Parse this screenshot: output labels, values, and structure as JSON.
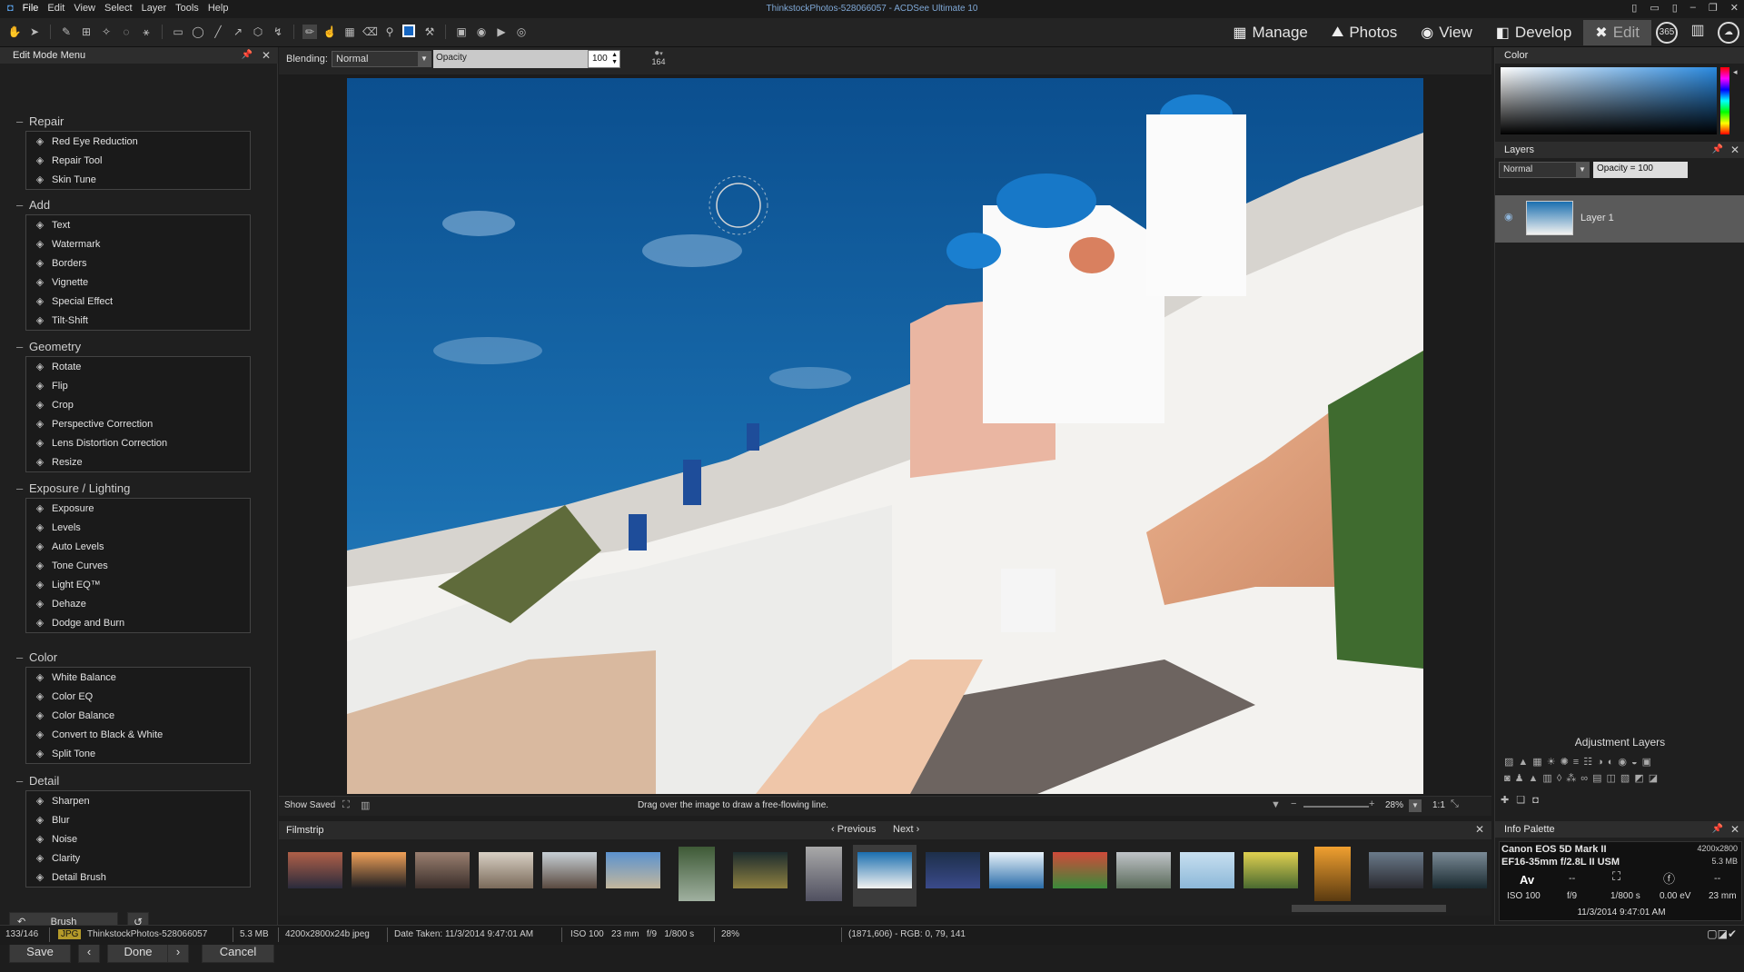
{
  "app": {
    "title": "ThinkstockPhotos-528066057 - ACDSee Ultimate 10"
  },
  "menu": [
    "File",
    "Edit",
    "View",
    "Select",
    "Layer",
    "Tools",
    "Help"
  ],
  "modes": [
    {
      "label": "Manage",
      "icon": "grid-icon"
    },
    {
      "label": "Photos",
      "icon": "photos-icon"
    },
    {
      "label": "View",
      "icon": "eye-icon"
    },
    {
      "label": "Develop",
      "icon": "develop-icon"
    },
    {
      "label": "Edit",
      "icon": "edit-icon",
      "active": true
    }
  ],
  "options": {
    "blending_label": "Blending:",
    "blending_value": "Normal",
    "opacity_label": "Opacity",
    "opacity_value": "100",
    "brush_size": "164"
  },
  "edit_menu": {
    "title": "Edit Mode Menu",
    "groups": [
      {
        "title": "Repair",
        "items": [
          {
            "label": "Red Eye Reduction",
            "icon": "eye-icon"
          },
          {
            "label": "Repair Tool",
            "icon": "bandage-icon"
          },
          {
            "label": "Skin Tune",
            "icon": "person-icon"
          }
        ]
      },
      {
        "title": "Add",
        "items": [
          {
            "label": "Text",
            "icon": "text-icon"
          },
          {
            "label": "Watermark",
            "icon": "watermark-icon"
          },
          {
            "label": "Borders",
            "icon": "borders-icon"
          },
          {
            "label": "Vignette",
            "icon": "vignette-icon"
          },
          {
            "label": "Special Effect",
            "icon": "wand-icon"
          },
          {
            "label": "Tilt-Shift",
            "icon": "tilt-shift-icon"
          }
        ]
      },
      {
        "title": "Geometry",
        "items": [
          {
            "label": "Rotate",
            "icon": "rotate-icon"
          },
          {
            "label": "Flip",
            "icon": "flip-icon"
          },
          {
            "label": "Crop",
            "icon": "crop-icon"
          },
          {
            "label": "Perspective Correction",
            "icon": "perspective-icon"
          },
          {
            "label": "Lens Distortion Correction",
            "icon": "lens-icon"
          },
          {
            "label": "Resize",
            "icon": "resize-icon"
          }
        ]
      },
      {
        "title": "Exposure / Lighting",
        "items": [
          {
            "label": "Exposure",
            "icon": "exposure-icon"
          },
          {
            "label": "Levels",
            "icon": "levels-icon"
          },
          {
            "label": "Auto Levels",
            "icon": "auto-levels-icon"
          },
          {
            "label": "Tone Curves",
            "icon": "curves-icon"
          },
          {
            "label": "Light EQ™",
            "icon": "light-eq-icon"
          },
          {
            "label": "Dehaze",
            "icon": "dehaze-icon"
          },
          {
            "label": "Dodge and Burn",
            "icon": "dodge-burn-icon"
          }
        ]
      },
      {
        "title": "Color",
        "items": [
          {
            "label": "White Balance",
            "icon": "white-balance-icon"
          },
          {
            "label": "Color EQ",
            "icon": "color-eq-icon"
          },
          {
            "label": "Color Balance",
            "icon": "color-balance-icon"
          },
          {
            "label": "Convert to Black & White",
            "icon": "bw-icon"
          },
          {
            "label": "Split Tone",
            "icon": "split-tone-icon"
          }
        ]
      },
      {
        "title": "Detail",
        "items": [
          {
            "label": "Sharpen",
            "icon": "sharpen-icon"
          },
          {
            "label": "Blur",
            "icon": "blur-icon"
          },
          {
            "label": "Noise",
            "icon": "noise-icon"
          },
          {
            "label": "Clarity",
            "icon": "clarity-icon"
          },
          {
            "label": "Detail Brush",
            "icon": "detail-brush-icon"
          }
        ]
      }
    ],
    "brush_label": "Brush",
    "save": "Save",
    "done": "Done",
    "cancel": "Cancel"
  },
  "canvas": {
    "show_saved": "Show Saved",
    "hint": "Drag over the image to draw a free-flowing line.",
    "zoom": "28%",
    "ratio": "1:1"
  },
  "filmstrip": {
    "title": "Filmstrip",
    "previous": "Previous",
    "next": "Next"
  },
  "color_panel": {
    "title": "Color"
  },
  "layers": {
    "title": "Layers",
    "blend": "Normal",
    "opacity": "Opacity = 100",
    "layer_name": "Layer 1",
    "adjustment_title": "Adjustment Layers"
  },
  "info": {
    "title": "Info Palette",
    "camera": "Canon EOS 5D Mark II",
    "lens": "EF16-35mm f/2.8L II USM",
    "dims": "4200x2800",
    "size": "5.3 MB",
    "mode": "Av",
    "meter": "--",
    "exp_comp": "--",
    "iso": "ISO 100",
    "fstop": "f/9",
    "shutter": "1/800 s",
    "ev": "0.00 eV",
    "focal": "23 mm",
    "date": "11/3/2014 9:47:01 AM"
  },
  "statusbar": {
    "index": "133/146",
    "type": "JPG",
    "filename": "ThinkstockPhotos-528066057",
    "size": "5.3 MB",
    "dims": "4200x2800x24b jpeg",
    "date_taken": "Date Taken: 11/3/2014 9:47:01 AM",
    "exif": "ISO 100   23 mm   f/9   1/800 s",
    "zoom": "28%",
    "pixel": "(1871,606) - RGB: 0, 79, 141"
  }
}
